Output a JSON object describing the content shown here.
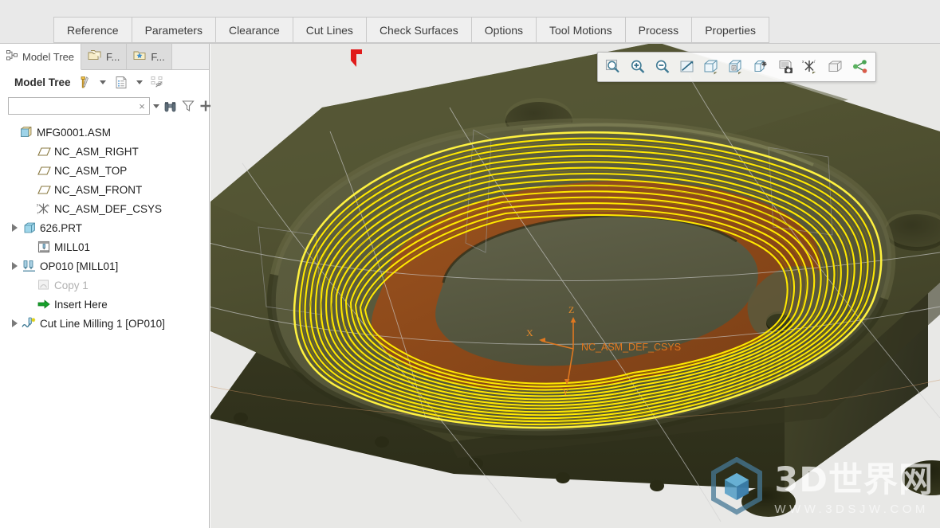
{
  "dashboard": {
    "tabs": [
      {
        "label": "Reference",
        "name": "tab-reference"
      },
      {
        "label": "Parameters",
        "name": "tab-parameters"
      },
      {
        "label": "Clearance",
        "name": "tab-clearance"
      },
      {
        "label": "Cut Lines",
        "name": "tab-cut-lines"
      },
      {
        "label": "Check Surfaces",
        "name": "tab-check-surfaces"
      },
      {
        "label": "Options",
        "name": "tab-options"
      },
      {
        "label": "Tool Motions",
        "name": "tab-tool-motions"
      },
      {
        "label": "Process",
        "name": "tab-process"
      },
      {
        "label": "Properties",
        "name": "tab-properties"
      }
    ]
  },
  "navigator": {
    "tabs": [
      {
        "label": "Model Tree",
        "icon": "model-tree-icon",
        "active": true
      },
      {
        "label": "F...",
        "icon": "folder-browser-icon",
        "active": false
      },
      {
        "label": "F...",
        "icon": "favorites-folder-icon",
        "active": false
      }
    ],
    "toolbar": {
      "title": "Model Tree",
      "settings_icon": "tools-hammer-screwdriver-icon",
      "settings_caret": "chevron-down-icon",
      "display_icon": "tree-columns-icon",
      "display_caret": "chevron-down-icon",
      "hide_icon": "tree-filter-hidden-icon"
    },
    "search": {
      "value": "",
      "placeholder": "",
      "clear_glyph": "×",
      "caret": "chevron-down-icon",
      "find_icon": "binoculars-find-icon",
      "filter_icon": "funnel-filter-icon",
      "add_icon": "plus-add-icon"
    },
    "tree": [
      {
        "label": "MFG0001.ASM",
        "icon": "assembly-icon",
        "indent": 0,
        "expander": "none",
        "dim": false
      },
      {
        "label": "NC_ASM_RIGHT",
        "icon": "datum-plane-icon",
        "indent": 1,
        "expander": "none",
        "dim": false
      },
      {
        "label": "NC_ASM_TOP",
        "icon": "datum-plane-icon",
        "indent": 1,
        "expander": "none",
        "dim": false
      },
      {
        "label": "NC_ASM_FRONT",
        "icon": "datum-plane-icon",
        "indent": 1,
        "expander": "none",
        "dim": false
      },
      {
        "label": "NC_ASM_DEF_CSYS",
        "icon": "coord-system-icon",
        "indent": 1,
        "expander": "none",
        "dim": false
      },
      {
        "label": "626.PRT",
        "icon": "part-icon",
        "indent": 1,
        "expander": "collapsed",
        "dim": false
      },
      {
        "label": "MILL01",
        "icon": "workcenter-mill-icon",
        "indent": 1,
        "expander": "none",
        "dim": false
      },
      {
        "label": "OP010 [MILL01]",
        "icon": "operation-icon",
        "indent": 1,
        "expander": "collapsed",
        "dim": false
      },
      {
        "label": "Copy 1",
        "icon": "copy-feature-icon",
        "indent": 1,
        "expander": "none",
        "dim": true
      },
      {
        "label": "Insert Here",
        "icon": "insert-arrow-icon",
        "indent": 1,
        "expander": "none",
        "dim": false
      },
      {
        "label": "Cut Line Milling 1 [OP010]",
        "icon": "cut-line-milling-icon",
        "indent": 1,
        "expander": "collapsed",
        "dim": false
      }
    ]
  },
  "viewport": {
    "graphics_toolbar": [
      {
        "name": "zoom-box-icon",
        "title": "Refit"
      },
      {
        "name": "zoom-in-icon",
        "title": "Zoom In"
      },
      {
        "name": "zoom-out-icon",
        "title": "Zoom Out"
      },
      {
        "name": "repaint-icon",
        "title": "Repaint"
      },
      {
        "name": "display-style-shaded-icon",
        "title": "Display Style"
      },
      {
        "name": "saved-views-icon",
        "title": "Saved Views"
      },
      {
        "name": "view-manager-icon",
        "title": "View Manager"
      },
      {
        "name": "layer-snapshot-icon",
        "title": "Layers / Capture"
      },
      {
        "name": "datum-display-icon",
        "title": "Datum Display Filters"
      },
      {
        "name": "perspective-view-icon",
        "title": "Perspective View"
      },
      {
        "name": "annotation-display-icon",
        "title": "Annotation Display"
      }
    ],
    "csys_label": "NC_ASM_DEF_CSYS",
    "axis_x": "X",
    "axis_y": "Y",
    "axis_z": "Z",
    "watermark_main": "3D世界网",
    "watermark_sub": "WWW.3DSJW.COM",
    "colors": {
      "toolpath": "#FFE800",
      "toolpath_dark": "#B59A00",
      "stock_top": "#4F5030",
      "stock_side": "#3B3C22",
      "surface_highlight": "#8C4A1A",
      "pocket_floor": "#5B5C3C",
      "csys_accent": "#E07820",
      "start_marker": "#E01B1B",
      "background": "#E8E8E6"
    }
  }
}
